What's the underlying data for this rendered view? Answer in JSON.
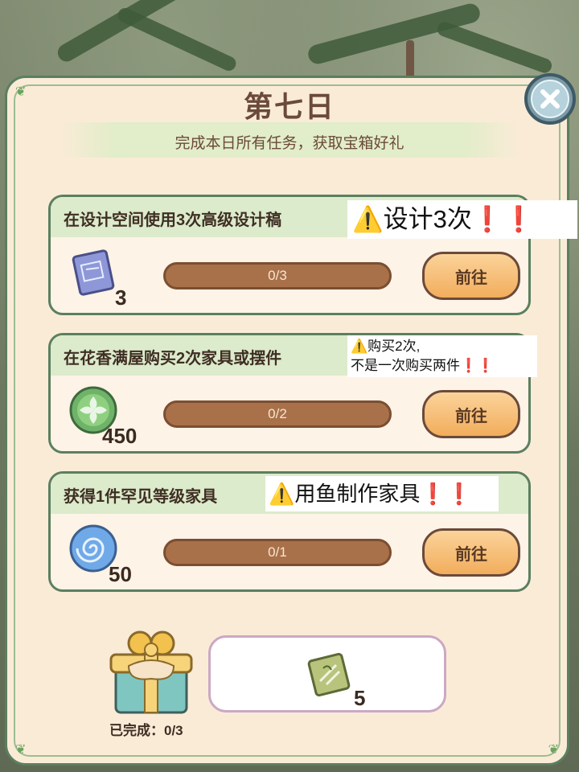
{
  "header": {
    "title": "第七日",
    "subtitle": "完成本日所有任务，获取宝箱好礼"
  },
  "close_button": {
    "icon": "close-icon"
  },
  "tasks": [
    {
      "label": "在设计空间使用3次高级设计稿",
      "progress": "0/3",
      "button": "前往",
      "reward_icon": "blueprint-scroll-icon",
      "reward_qty": "3",
      "warning": {
        "icon": "warning-icon",
        "text": "设计3次",
        "marks": "❗❗"
      }
    },
    {
      "label": "在花香满屋购买2次家具或摆件",
      "progress": "0/2",
      "button": "前往",
      "reward_icon": "green-leaf-coin-icon",
      "reward_qty": "450",
      "warning": {
        "icon": "warning-icon",
        "line1": "购买2次,",
        "line2": "不是一次购买两件",
        "marks": "❗❗"
      }
    },
    {
      "label": "获得1件罕见等级家具",
      "progress": "0/1",
      "button": "前往",
      "reward_icon": "blue-swirl-orb-icon",
      "reward_qty": "50",
      "warning": {
        "icon": "warning-icon",
        "text": "用鱼制作家具",
        "marks": "❗❗"
      }
    }
  ],
  "chest": {
    "icon": "gift-chest-icon",
    "status": "已完成：0/3"
  },
  "final_reward": {
    "icon": "bamboo-seed-packet-icon",
    "qty": "5"
  },
  "colors": {
    "accent_green": "#5b7f5f",
    "panel": "#faebd7",
    "progress_fill": "#a9714a",
    "button": "#f2ad5c",
    "warning_red": "#e0191f"
  }
}
